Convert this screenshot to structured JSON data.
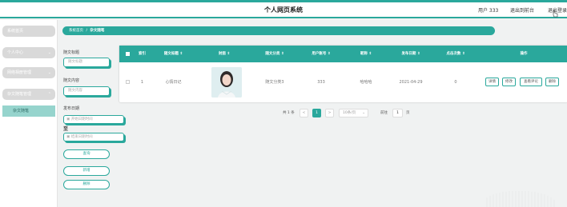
{
  "header": {
    "title": "个人网页系统",
    "user_info": "用户 333",
    "back_home": "退出到前台",
    "logout": "退出登录"
  },
  "sidebar": {
    "items": [
      {
        "label": "系统首页"
      },
      {
        "label": "个人中心",
        "arrow": "⌄"
      },
      {
        "label": "网络相册管理",
        "arrow": "⌄"
      },
      {
        "label": "杂文随笔管理",
        "arrow": "⌃"
      }
    ],
    "submenu": {
      "label": "杂文随笔"
    }
  },
  "breadcrumb": {
    "home": "系统首页",
    "sep": "/",
    "current": "杂文随笔"
  },
  "search": {
    "title_label": "随文标题",
    "title_placeholder": "随文标题",
    "content_label": "随文内容",
    "content_placeholder": "随文内容",
    "date_label": "发布日期",
    "start_placeholder": "开始日期时间",
    "date_sep": "至",
    "end_placeholder": "结束日期时间",
    "query_button": "查询",
    "add_button": "新增",
    "delete_button": "删除"
  },
  "table": {
    "headers": [
      "索引",
      "随文标题 ⇕",
      "封面 ⇕",
      "随文分类 ⇕",
      "用户账号 ⇕",
      "昵称 ⇕",
      "发布日期 ⇕",
      "点击次数 ⇕",
      "操作"
    ],
    "rows": [
      {
        "index": "1",
        "title": "心情日记",
        "category": "随文分类3",
        "account": "333",
        "nickname": "哈哈哈",
        "date": "2021-04-29",
        "clicks": "0",
        "actions": [
          "详情",
          "修改",
          "查看评论",
          "删除"
        ]
      }
    ]
  },
  "pagination": {
    "total": "共 1 条",
    "prev": "<",
    "page": "1",
    "next": ">",
    "page_size": "10条/页",
    "goto_label": "前往",
    "goto_value": "1",
    "page_unit": "页"
  },
  "colors": {
    "accent": "#2aa89c",
    "sidebar_item": "#d9d9d9",
    "submenu_active": "#96d4cd"
  }
}
